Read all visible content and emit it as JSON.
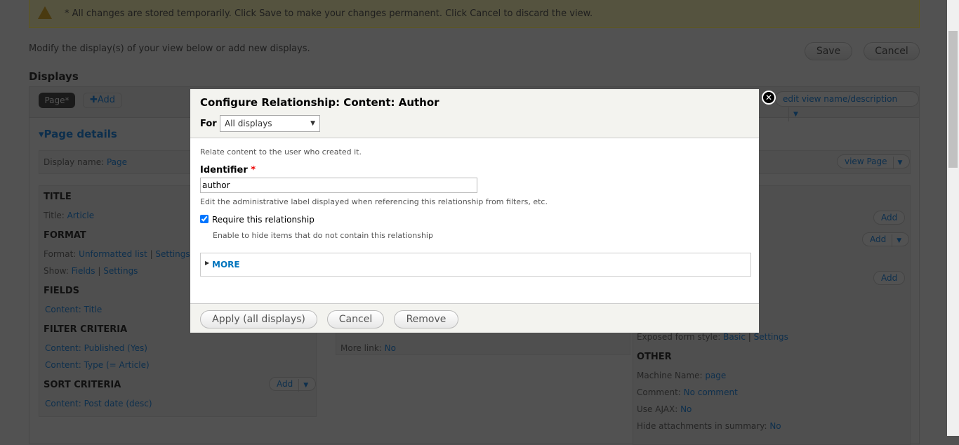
{
  "warning": {
    "text": "* All changes are stored temporarily. Click Save to make your changes permanent. Click Cancel to discard the view."
  },
  "intro": "Modify the display(s) of your view below or add new displays.",
  "actions": {
    "save": "Save",
    "cancel": "Cancel"
  },
  "displays": {
    "heading": "Displays",
    "tab_page": "Page*",
    "add": "Add",
    "edit_view": "edit view name/description"
  },
  "page_details": {
    "heading": "Page details",
    "display_name_label": "Display name:",
    "display_name_value": "Page",
    "view_page": "view Page"
  },
  "left": {
    "title_h": "TITLE",
    "title_label": "Title:",
    "title_value": "Article",
    "format_h": "FORMAT",
    "format_label": "Format:",
    "format_value": "Unformatted list",
    "format_settings": "Settings",
    "show_label": "Show:",
    "show_value": "Fields",
    "show_settings": "Settings",
    "fields_h": "FIELDS",
    "field1": "Content: Title",
    "filter_h": "FILTER CRITERIA",
    "filter1": "Content: Published (Yes)",
    "filter2": "Content: Type (= Article)",
    "sort_h": "SORT CRITERIA",
    "sort_add": "Add",
    "sort1": "Content: Post date (desc)"
  },
  "middle": {
    "more_link_label": "More link:",
    "more_link_value": "No"
  },
  "right": {
    "add1": "Add",
    "add2": "Add",
    "add3": "Add",
    "exposed_label": "Exposed form style:",
    "exposed_value": "Basic",
    "exposed_settings": "Settings",
    "other_h": "OTHER",
    "machine_label": "Machine Name:",
    "machine_value": "page",
    "comment_label": "Comment:",
    "comment_value": "No comment",
    "ajax_label": "Use AJAX:",
    "ajax_value": "No",
    "hide_label": "Hide attachments in summary:",
    "hide_value": "No"
  },
  "modal": {
    "title": "Configure Relationship: Content: Author",
    "for_label": "For",
    "for_value": "All displays",
    "description": "Relate content to the user who created it.",
    "identifier_label": "Identifier",
    "required_mark": "*",
    "identifier_value": "author",
    "identifier_help": "Edit the administrative label displayed when referencing this relationship from filters, etc.",
    "require_label": "Require this relationship",
    "require_checked": true,
    "require_help": "Enable to hide items that do not contain this relationship",
    "more": "MORE",
    "apply": "Apply (all displays)",
    "cancel": "Cancel",
    "remove": "Remove"
  }
}
